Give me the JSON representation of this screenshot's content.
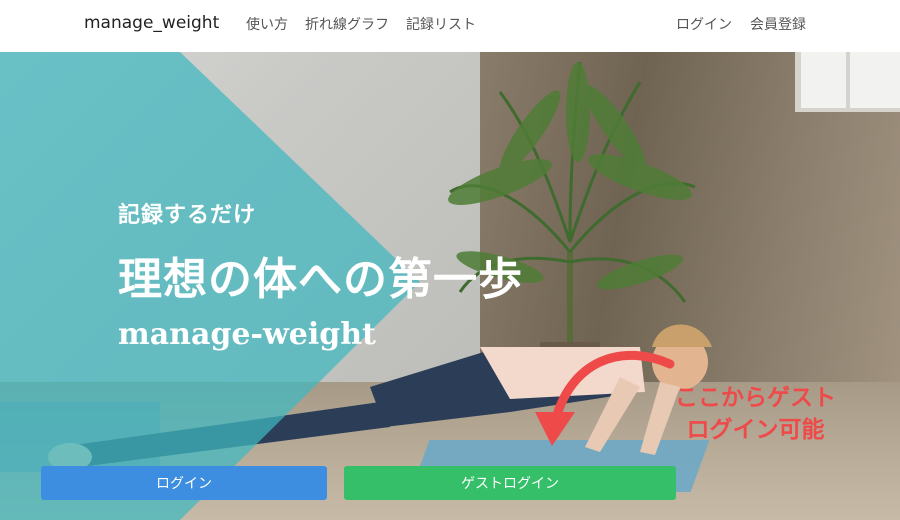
{
  "navbar": {
    "brand": "manage_weight",
    "left_links": [
      "使い方",
      "折れ線グラフ",
      "記録リスト"
    ],
    "right_links": [
      "ログイン",
      "会員登録"
    ]
  },
  "hero": {
    "subtitle": "記録するだけ",
    "title": "理想の体への第一歩",
    "app_name": "manage-weight",
    "annotation": [
      "ここからゲスト",
      "ログイン可能"
    ]
  },
  "buttons": {
    "login": "ログイン",
    "guest_login": "ゲストログイン"
  },
  "colors": {
    "teal_overlay": "#3fb8c0",
    "login_button": "#3d8ee0",
    "guest_button": "#34bf68",
    "annotation": "#ef4a4a"
  }
}
